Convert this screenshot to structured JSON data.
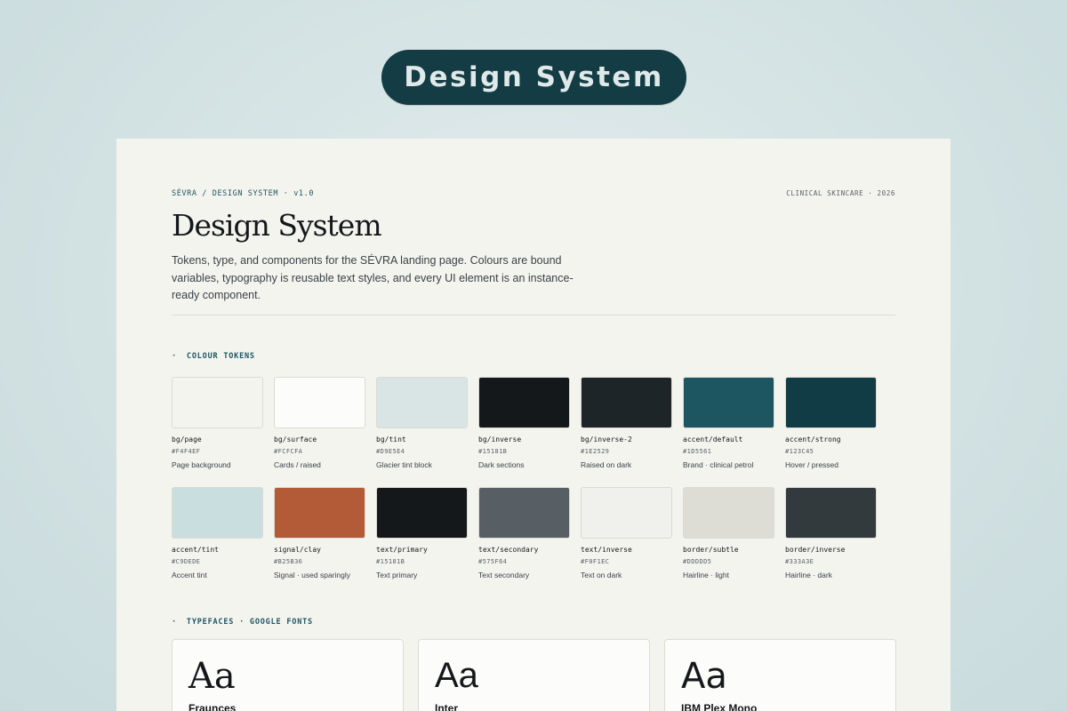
{
  "hero": {
    "pill_label": "Design System"
  },
  "header": {
    "breadcrumb": "SÉVRA / DESIGN SYSTEM · v1.0",
    "meta": "CLINICAL SKINCARE · 2026",
    "title": "Design System",
    "lead": "Tokens, type, and components for the SÉVRA landing page. Colours are bound variables, typography is reusable text styles, and every UI element is an instance-ready component."
  },
  "colour_section": {
    "label": "COLOUR TOKENS",
    "rows": [
      [
        {
          "name": "bg/page",
          "hex": "#F4F4EF",
          "desc": "Page background",
          "color": "#f4f4ef"
        },
        {
          "name": "bg/surface",
          "hex": "#FCFCFA",
          "desc": "Cards / raised",
          "color": "#fcfcfa"
        },
        {
          "name": "bg/tint",
          "hex": "#D9E5E4",
          "desc": "Glacier tint block",
          "color": "#d9e5e4"
        },
        {
          "name": "bg/inverse",
          "hex": "#15181B",
          "desc": "Dark sections",
          "color": "#15181b"
        },
        {
          "name": "bg/inverse-2",
          "hex": "#1E2529",
          "desc": "Raised on dark",
          "color": "#1e2529"
        },
        {
          "name": "accent/default",
          "hex": "#1D5561",
          "desc": "Brand · clinical petrol",
          "color": "#1d5561"
        },
        {
          "name": "accent/strong",
          "hex": "#123C45",
          "desc": "Hover / pressed",
          "color": "#123c45"
        }
      ],
      [
        {
          "name": "accent/tint",
          "hex": "#C9DEDE",
          "desc": "Accent tint",
          "color": "#c9dede"
        },
        {
          "name": "signal/clay",
          "hex": "#B25B36",
          "desc": "Signal · used sparingly",
          "color": "#b25b36"
        },
        {
          "name": "text/primary",
          "hex": "#15181B",
          "desc": "Text primary",
          "color": "#15181b"
        },
        {
          "name": "text/secondary",
          "hex": "#575F64",
          "desc": "Text secondary",
          "color": "#575f64"
        },
        {
          "name": "text/inverse",
          "hex": "#F0F1EC",
          "desc": "Text on dark",
          "color": "#f0f1ec"
        },
        {
          "name": "border/subtle",
          "hex": "#DDDDD5",
          "desc": "Hairline · light",
          "color": "#dddcd5"
        },
        {
          "name": "border/inverse",
          "hex": "#333A3E",
          "desc": "Hairline · dark",
          "color": "#333a3e"
        }
      ]
    ]
  },
  "type_section": {
    "label": "TYPEFACES · GOOGLE FONTS",
    "cards": [
      {
        "sample": "Aa",
        "name": "Fraunces"
      },
      {
        "sample": "Aa",
        "name": "Inter"
      },
      {
        "sample": "Aa",
        "name": "IBM Plex Mono"
      }
    ]
  }
}
